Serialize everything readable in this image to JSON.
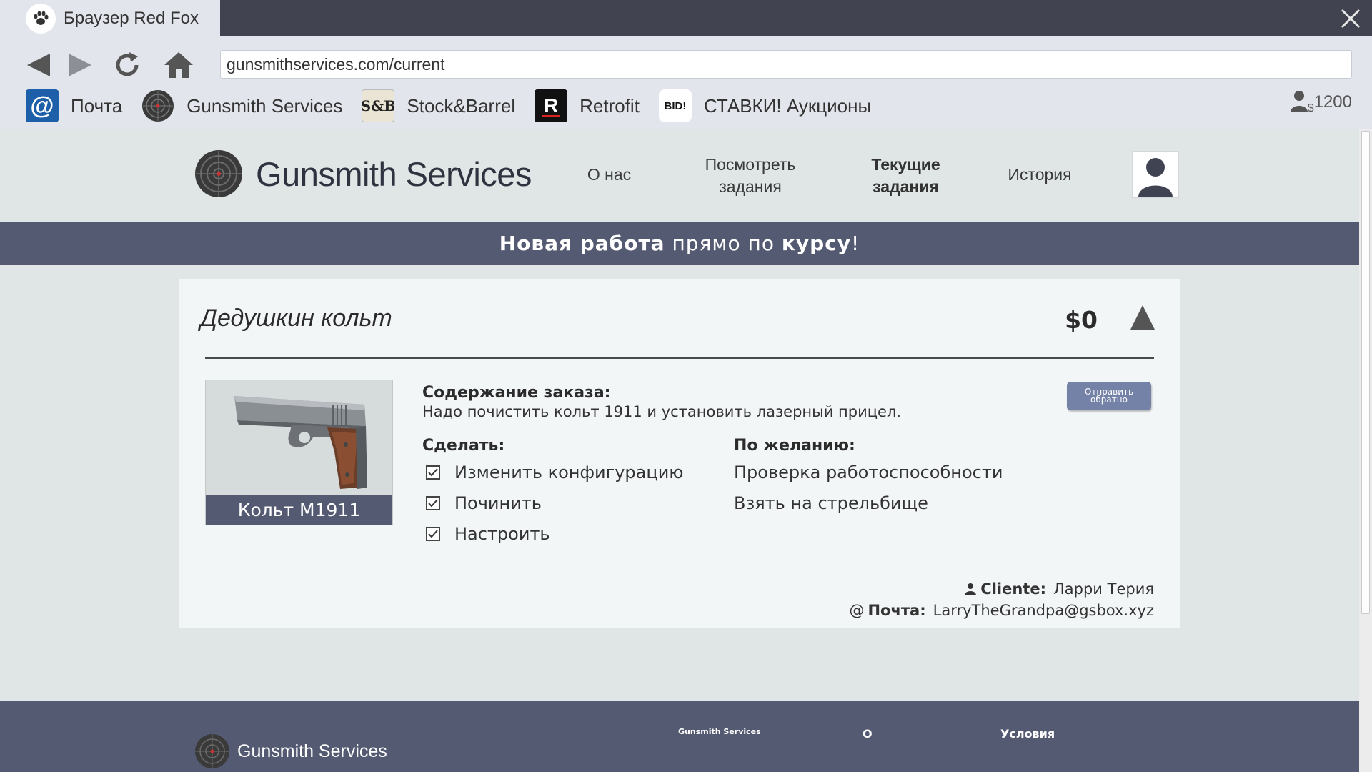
{
  "browser": {
    "tab_title": "Браузер Red Fox",
    "url": "gunsmithservices.com/current",
    "bookmarks": [
      {
        "label": "Почта",
        "icon": "mail-at-icon"
      },
      {
        "label": "Gunsmith Services",
        "icon": "gunsmith-target-icon"
      },
      {
        "label": "Stock&Barrel",
        "icon": "stock-barrel-icon"
      },
      {
        "label": "Retrofit",
        "icon": "retrofit-r-icon"
      },
      {
        "label": "СТАВКИ! Аукционы",
        "icon": "bid-icon"
      }
    ],
    "bid_icon_text": "BID!",
    "balance": "1200",
    "balance_symbol": "$"
  },
  "site": {
    "brand": "Gunsmith Services",
    "nav": [
      {
        "label": "О нас"
      },
      {
        "label": "Посмотреть задания"
      },
      {
        "label": "Текущие задания",
        "active": true
      },
      {
        "label": "История"
      }
    ]
  },
  "banner": {
    "part1": "Новая работа",
    "part2": " прямо по ",
    "part3": "курсу",
    "part4": "!"
  },
  "job": {
    "title": "Дедушкин кольт",
    "price": "$0",
    "weapon_name": "Кольт M1911",
    "order_label": "Содержание заказа:",
    "order_text": "Надо почистить кольт 1911 и установить лазерный прицел.",
    "send_back_label": "Отправить обратно",
    "todo_label": "Сделать:",
    "todo": [
      "Изменить конфигурацию",
      "Починить",
      "Настроить"
    ],
    "optional_label": "По желанию:",
    "optional": [
      "Проверка работоспособности",
      "Взять на стрельбище"
    ],
    "client_label": "Cliente:",
    "client_name": "Ларри Терия",
    "email_label": "Почта:",
    "email_prefix": "@",
    "email": "LarryTheGrandpa@gsbox.xyz"
  },
  "footer": {
    "brand": "Gunsmith Services",
    "col1": "Gunsmith Services",
    "col2": "О",
    "col3": "Условия"
  },
  "colors": {
    "chrome_dark": "#414350",
    "chrome_light": "#e3e5ec",
    "accent": "#545a71",
    "button": "#7582a7",
    "page_bg": "#e0e6e6"
  }
}
